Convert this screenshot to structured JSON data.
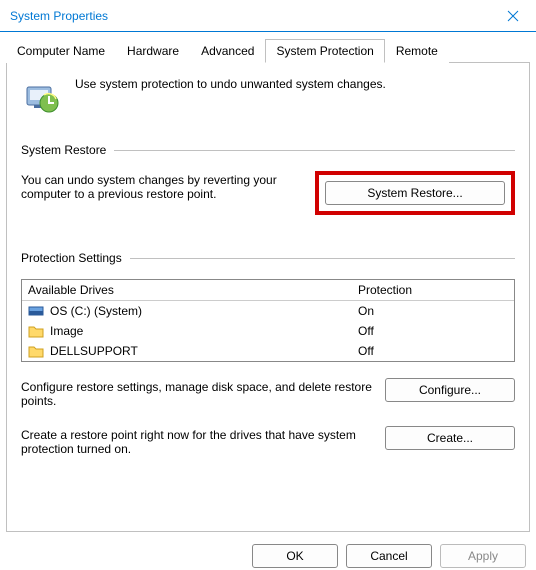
{
  "window": {
    "title": "System Properties"
  },
  "tabs": [
    {
      "label": "Computer Name"
    },
    {
      "label": "Hardware"
    },
    {
      "label": "Advanced"
    },
    {
      "label": "System Protection"
    },
    {
      "label": "Remote"
    }
  ],
  "intro": {
    "text": "Use system protection to undo unwanted system changes."
  },
  "restore": {
    "group_label": "System Restore",
    "desc": "You can undo system changes by reverting your computer to a previous restore point.",
    "button": "System Restore..."
  },
  "protection": {
    "group_label": "Protection Settings",
    "col_drive": "Available Drives",
    "col_prot": "Protection",
    "drives": [
      {
        "name": "OS (C:) (System)",
        "prot": "On",
        "type": "disk"
      },
      {
        "name": "Image",
        "prot": "Off",
        "type": "folder"
      },
      {
        "name": "DELLSUPPORT",
        "prot": "Off",
        "type": "folder"
      }
    ],
    "configure_desc": "Configure restore settings, manage disk space, and delete restore points.",
    "configure_btn": "Configure...",
    "create_desc": "Create a restore point right now for the drives that have system protection turned on.",
    "create_btn": "Create..."
  },
  "footer": {
    "ok": "OK",
    "cancel": "Cancel",
    "apply": "Apply"
  }
}
